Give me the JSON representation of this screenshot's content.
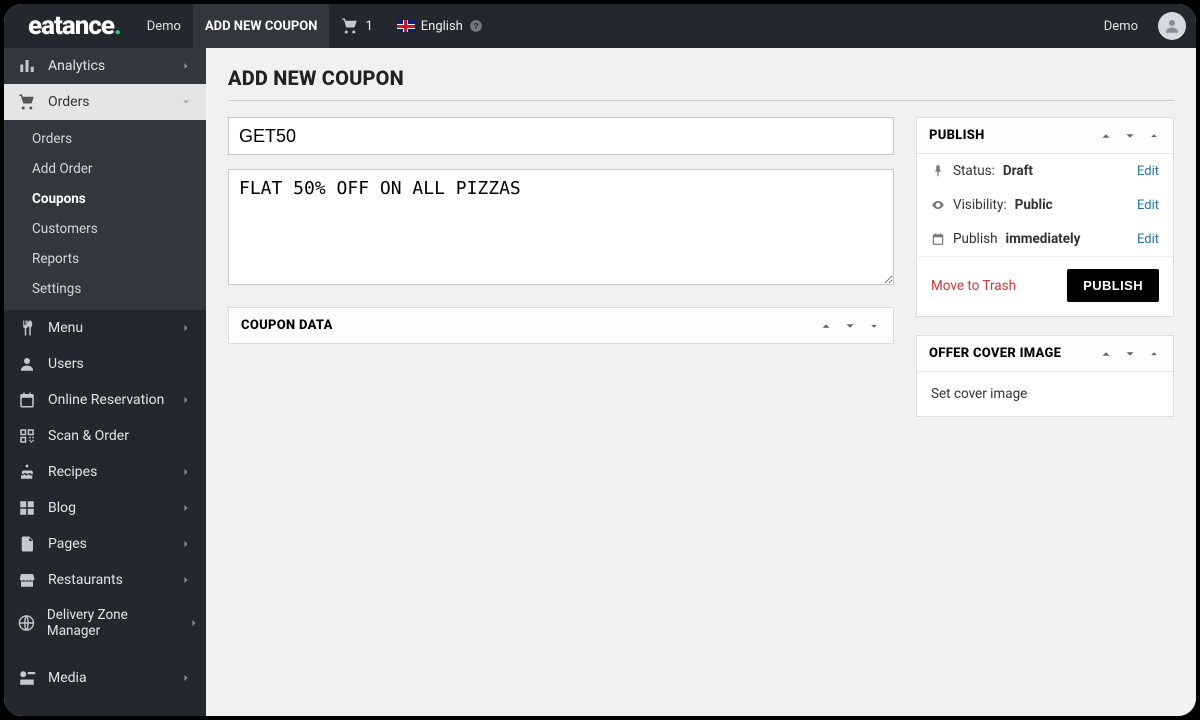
{
  "topbar": {
    "brand_a": "eatance",
    "brand_dot": ".",
    "demo": "Demo",
    "add_new": "ADD NEW COUPON",
    "cart_count": "1",
    "language": "English",
    "user": "Demo"
  },
  "sidebar": {
    "analytics": "Analytics",
    "orders_head": "Orders",
    "orders_sub": [
      "Orders",
      "Add Order",
      "Coupons",
      "Customers",
      "Reports",
      "Settings"
    ],
    "orders_active_index": 2,
    "menu": "Menu",
    "users": "Users",
    "online_reservation": "Online Reservation",
    "scan_order": "Scan & Order",
    "recipes": "Recipes",
    "blog": "Blog",
    "pages": "Pages",
    "restaurants": "Restaurants",
    "delivery_zone": "Delivery Zone Manager",
    "media": "Media"
  },
  "page": {
    "title": "ADD NEW COUPON",
    "coupon_title": "GET50",
    "coupon_desc": "FLAT 50% OFF ON ALL PIZZAS",
    "coupon_data_head": "COUPON DATA"
  },
  "publish": {
    "panel_title": "PUBLISH",
    "status_label": "Status: ",
    "status_value": "Draft",
    "visibility_label": "Visibility: ",
    "visibility_value": "Public",
    "schedule_label": "Publish ",
    "schedule_value": "immediately",
    "edit": "Edit",
    "trash": "Move to Trash",
    "button": "PUBLISH"
  },
  "cover": {
    "panel_title": "OFFER COVER IMAGE",
    "set_text": "Set cover image"
  }
}
